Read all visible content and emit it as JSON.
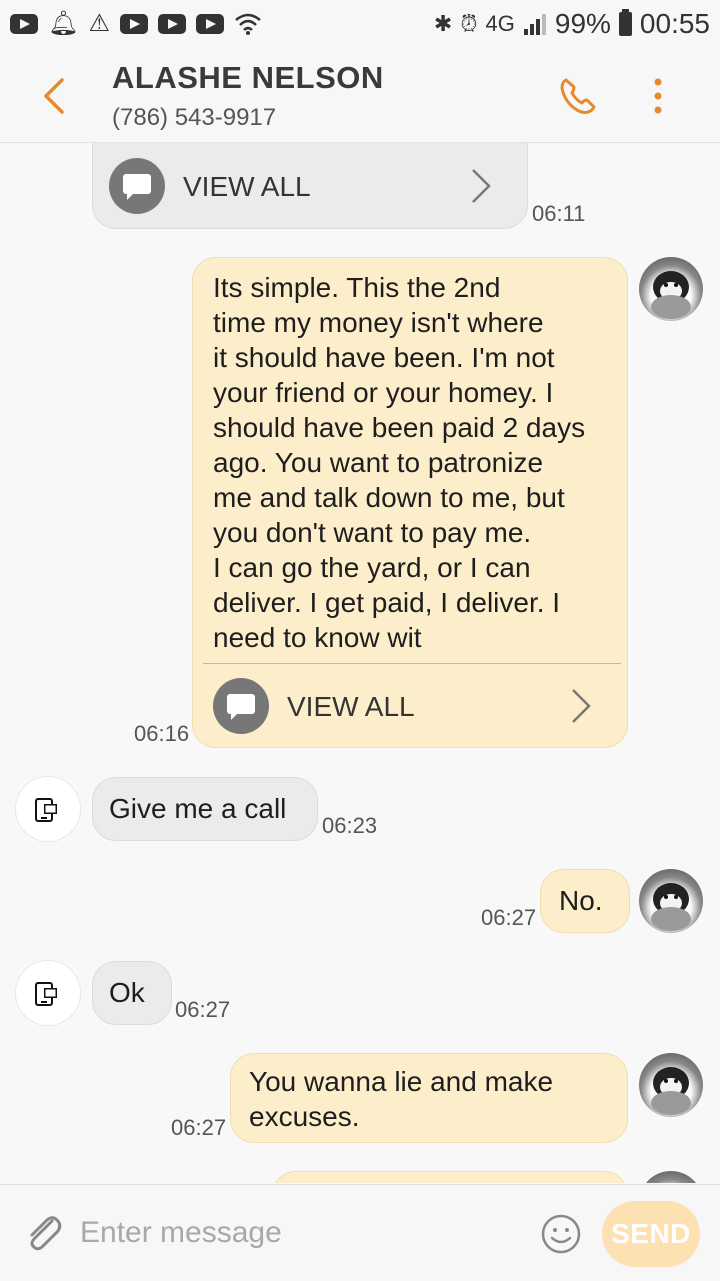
{
  "status_bar": {
    "left_icons": [
      "youtube-icon",
      "notification-bell-icon",
      "warning-icon",
      "youtube-icon",
      "youtube-icon",
      "youtube-icon",
      "wifi-icon"
    ],
    "right_icons": [
      "bluetooth-icon",
      "alarm-icon",
      "4g-lte-icon",
      "signal-icon",
      "battery-icon"
    ],
    "network": "4G",
    "battery": "99%",
    "time": "00:55"
  },
  "header": {
    "contact_name": "ALASHE NELSON",
    "contact_phone": "(786) 543-9917",
    "accent_color": "#e68a2e"
  },
  "messages": [
    {
      "direction": "in",
      "type": "view_all_fragment",
      "view_all_label": "VIEW ALL",
      "time": "06:11"
    },
    {
      "direction": "out",
      "type": "long",
      "text": "Its simple. This the 2nd\ntime my money isn't where\nit should have been.  I'm not\nyour friend or your homey. I\nshould have been paid 2 days\nago. You want to patronize\nme and talk down to me, but\nyou don't want to pay me.\nI can go the yard, or I  can\ndeliver. I get paid, I deliver.  I\nneed to know wit",
      "view_all_label": "VIEW ALL",
      "time": "06:16",
      "avatar": "penguin-avatar"
    },
    {
      "direction": "in",
      "text": "Give me a call",
      "time": "06:23",
      "avatar": "id-logo-avatar"
    },
    {
      "direction": "out",
      "text": "No.",
      "time": "06:27",
      "avatar": "penguin-avatar"
    },
    {
      "direction": "in",
      "text": "Ok",
      "time": "06:27",
      "avatar": "id-logo-avatar"
    },
    {
      "direction": "out",
      "text": "You wanna lie and make\nexcuses.",
      "time": "06:27",
      "avatar": "penguin-avatar"
    }
  ],
  "composer": {
    "placeholder": "Enter message",
    "send_label": "SEND",
    "send_color": "#fde1b3"
  }
}
